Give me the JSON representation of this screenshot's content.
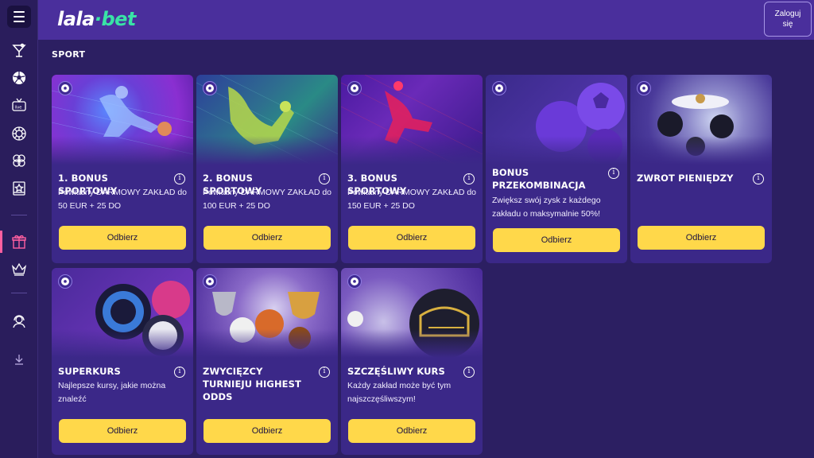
{
  "header": {
    "logo_main": "lala",
    "logo_dot": "·",
    "logo_suffix": "bet",
    "login_label_line1": "Zaloguj",
    "login_label_line2": "się"
  },
  "section": {
    "title": "SPORT"
  },
  "sidebar": {
    "items": [
      {
        "name": "cocktail-icon"
      },
      {
        "name": "soccer-ball-icon"
      },
      {
        "name": "live-tv-icon"
      },
      {
        "name": "roulette-icon"
      },
      {
        "name": "poker-chips-icon"
      },
      {
        "name": "lottery-ticket-icon"
      },
      {
        "name": "gift-icon"
      },
      {
        "name": "crown-icon"
      },
      {
        "name": "support-agent-icon"
      },
      {
        "name": "download-icon"
      }
    ]
  },
  "colors": {
    "accent_yellow": "#ffd84a",
    "brand_green": "#39e3a6",
    "active_pink": "#ff5fa0",
    "card_bg": "#3b2888",
    "header_bg": "#4a2f9c"
  },
  "cards": [
    {
      "title": "1. BONUS SPORTOWY",
      "desc": "Powitalny DARMOWY ZAKŁAD do 50 EUR + 25 DO",
      "button": "Odbierz"
    },
    {
      "title": "2. BONUS SPORTOWY",
      "desc": "Powitalny DARMOWY ZAKŁAD do 100 EUR + 25 DO",
      "button": "Odbierz"
    },
    {
      "title": "3. BONUS SPORTOWY",
      "desc": "Powitalny DARMOWY ZAKŁAD do 150 EUR + 25 DO",
      "button": "Odbierz"
    },
    {
      "title": "BONUS PRZEKOMBINACJA",
      "desc": "Zwiększ swój zysk z każdego zakładu o maksymalnie 50%!",
      "button": "Odbierz"
    },
    {
      "title": "ZWROT PIENIĘDZY",
      "desc": "",
      "button": "Odbierz"
    },
    {
      "title": "SUPERKURS",
      "desc": "Najlepsze kursy, jakie można znaleźć",
      "button": "Odbierz"
    },
    {
      "title": "ZWYCIĘZCY TURNIEJU HIGHEST ODDS",
      "desc": "",
      "button": "Odbierz"
    },
    {
      "title": "SZCZĘŚLIWY KURS",
      "desc": "Każdy zakład może być tym najszczęśliwszym!",
      "button": "Odbierz"
    }
  ]
}
